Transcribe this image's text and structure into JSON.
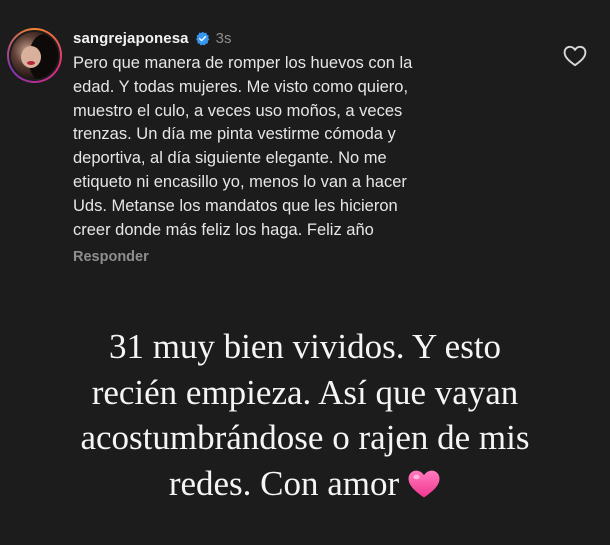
{
  "comment": {
    "username": "sangrejaponesa",
    "verified": true,
    "timestamp": "3s",
    "text": "Pero que manera de romper los huevos con la\nedad. Y todas mujeres. Me visto como quiero,\nmuestro el culo, a veces uso moños, a veces\ntrenzas. Un día me pinta vestirme cómoda y\ndeportiva, al día siguiente elegante. No me\netiqueto ni encasillo yo, menos lo van a hacer\nUds. Metanse los mandatos que les hicieron\ncreer donde más feliz los haga. Feliz año",
    "reply_label": "Responder",
    "like_icon": "heart-outline-icon"
  },
  "caption": {
    "lines": [
      "31 muy bien vividos. Y esto",
      "recién empieza. Así que vayan",
      "acostumbrándose o rajen de mis",
      "redes. Con amor"
    ],
    "trailing_icon": "pink-heart-icon"
  },
  "colors": {
    "background": "#1c1c1c",
    "verified_badge": "#3797f0",
    "heart_pink": "#ff4fa3",
    "secondary_text": "#8e8e8e"
  }
}
